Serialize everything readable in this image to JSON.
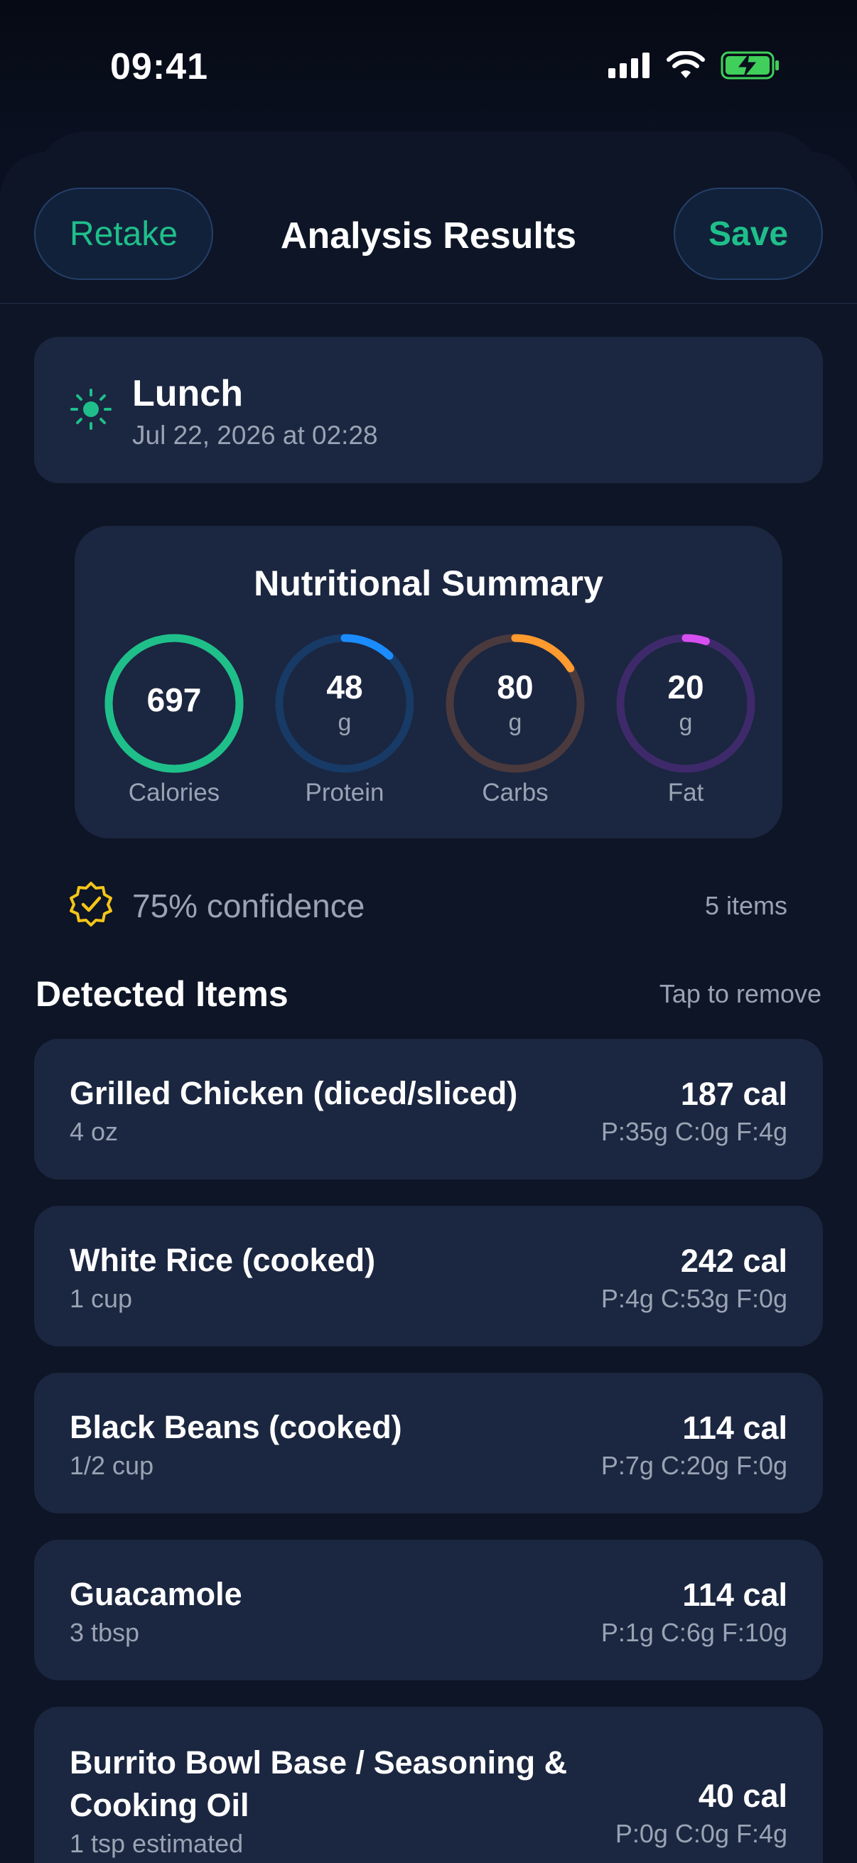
{
  "status": {
    "time": "09:41"
  },
  "nav": {
    "retake_label": "Retake",
    "title": "Analysis Results",
    "save_label": "Save"
  },
  "meal": {
    "name": "Lunch",
    "date": "Jul 22, 2026 at 02:28",
    "icon": "sun-icon"
  },
  "summary": {
    "title": "Nutritional Summary",
    "rings": [
      {
        "value": "697",
        "unit": "",
        "label": "Calories",
        "color": "#1fbf8a",
        "track": "#1fbf8a",
        "fraction": 1.0
      },
      {
        "value": "48",
        "unit": "g",
        "label": "Protein",
        "color": "#1a8cff",
        "track": "#173a66",
        "fraction": 0.12
      },
      {
        "value": "80",
        "unit": "g",
        "label": "Carbs",
        "color": "#ff9a2e",
        "track": "#4a3a3e",
        "fraction": 0.16
      },
      {
        "value": "20",
        "unit": "g",
        "label": "Fat",
        "color": "#d64ff0",
        "track": "#3e2a6a",
        "fraction": 0.05
      }
    ]
  },
  "confidence": {
    "text": "75% confidence",
    "items_count": "5 items"
  },
  "detected": {
    "title": "Detected Items",
    "hint": "Tap to remove",
    "items": [
      {
        "name": "Grilled Chicken (diced/sliced)",
        "portion": "4 oz",
        "calories": "187 cal",
        "macros": "P:35g C:0g F:4g"
      },
      {
        "name": "White Rice (cooked)",
        "portion": "1 cup",
        "calories": "242 cal",
        "macros": "P:4g C:53g F:0g"
      },
      {
        "name": "Black Beans (cooked)",
        "portion": "1/2 cup",
        "calories": "114 cal",
        "macros": "P:7g C:20g F:0g"
      },
      {
        "name": "Guacamole",
        "portion": "3 tbsp",
        "calories": "114 cal",
        "macros": "P:1g C:6g F:10g"
      },
      {
        "name_line1": "Burrito Bowl Base / Seasoning &",
        "name_line2": "Cooking Oil",
        "portion": "1 tsp estimated",
        "calories": "40 cal",
        "macros": "P:0g C:0g F:4g"
      }
    ]
  },
  "colors": {
    "accent": "#1fbf8a",
    "card": "#1b2640",
    "background": "#0d1526",
    "badge": "#f5c518"
  }
}
